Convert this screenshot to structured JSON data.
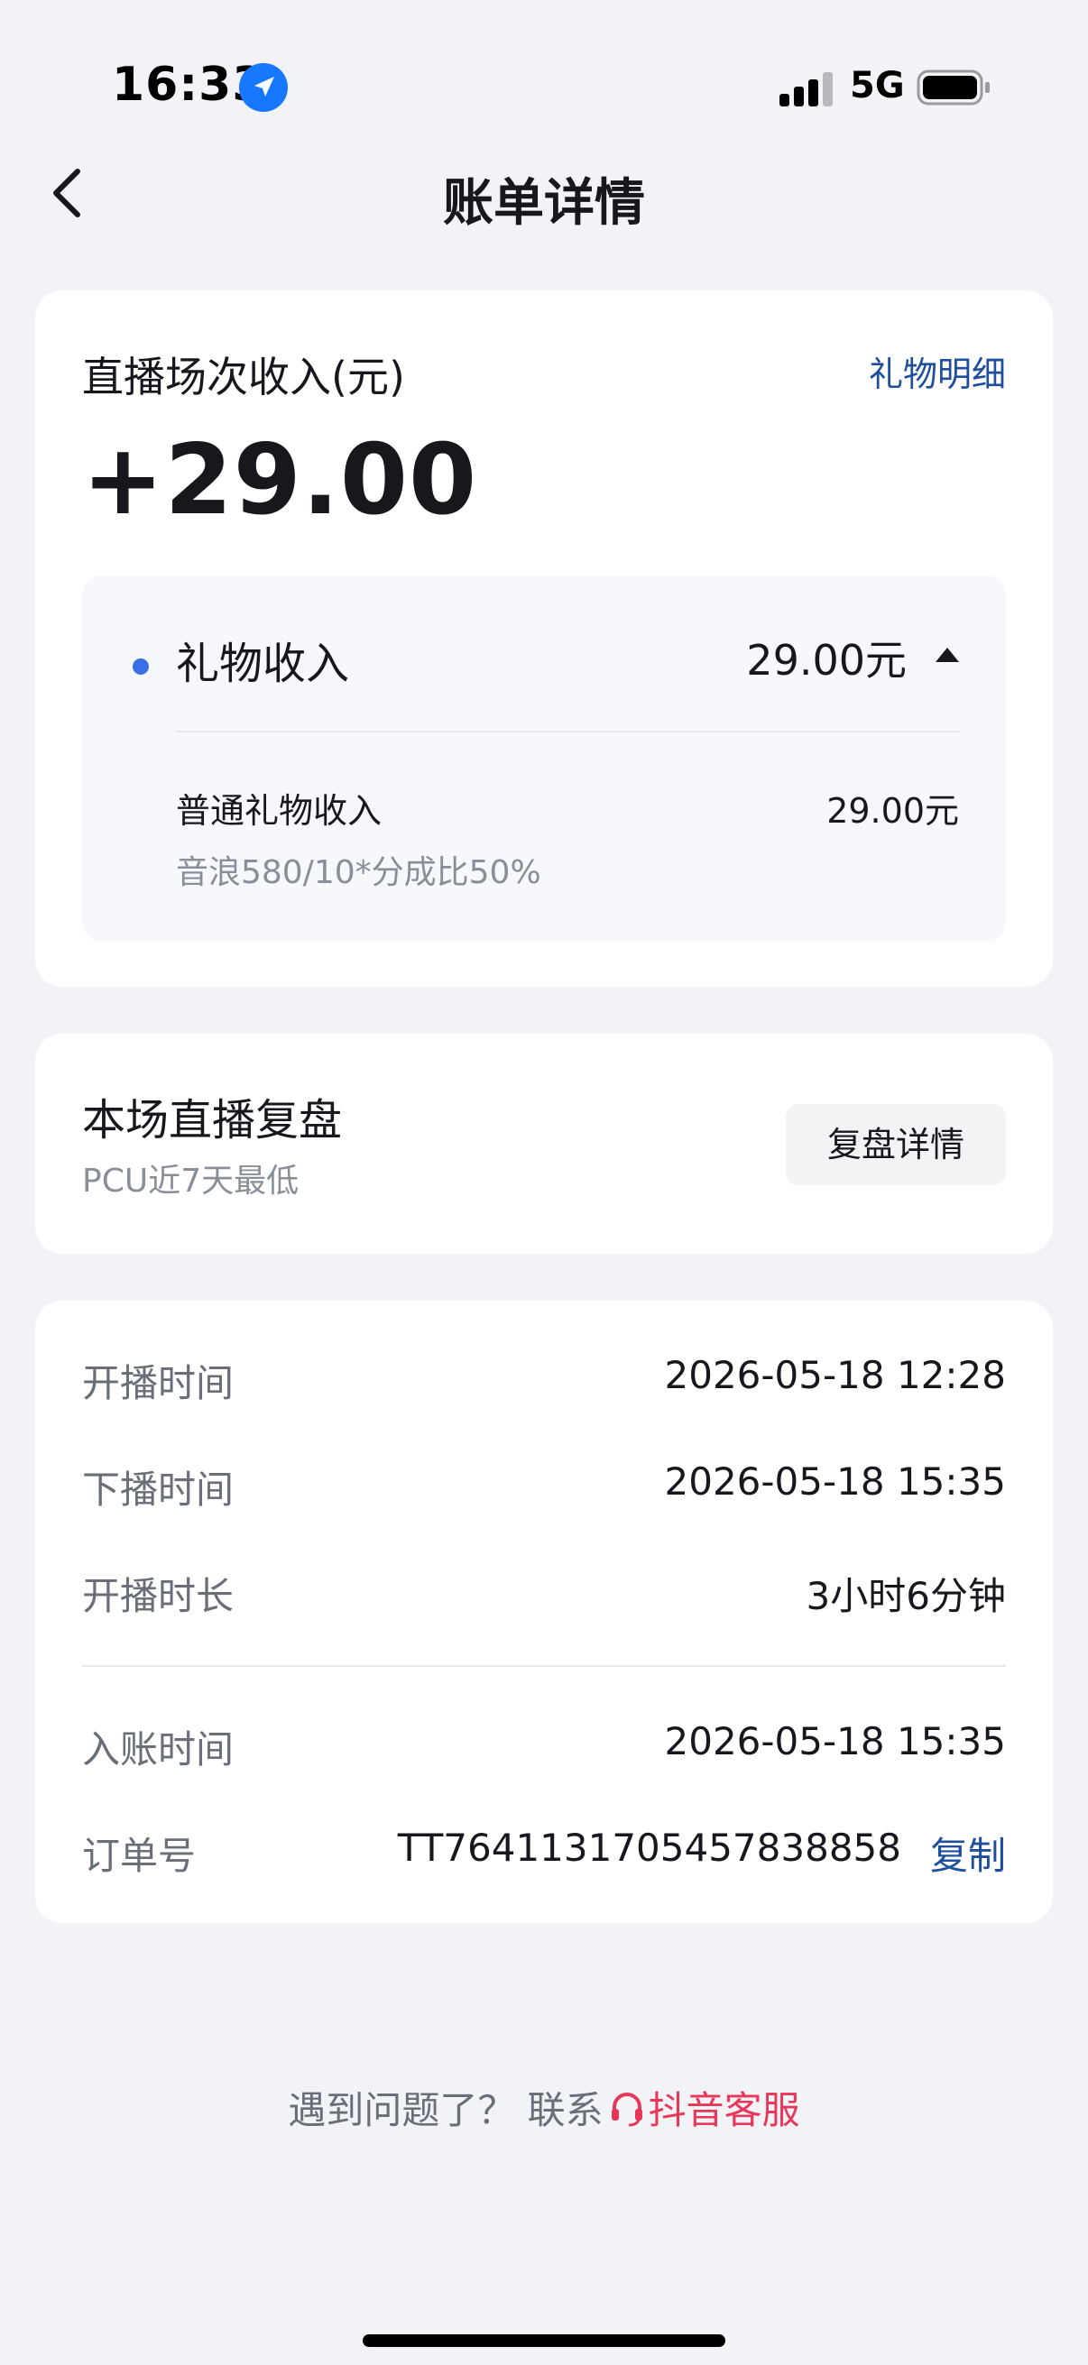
{
  "status_bar": {
    "time": "16:33",
    "network": "5G"
  },
  "nav": {
    "title": "账单详情"
  },
  "income": {
    "title": "直播场次收入(元)",
    "detail_link": "礼物明细",
    "amount": "+29.00",
    "gift_income_label": "礼物收入",
    "gift_income_value": "29.00元",
    "normal_gift_label": "普通礼物收入",
    "normal_gift_value": "29.00元",
    "normal_gift_formula": "音浪580/10*分成比50%"
  },
  "review": {
    "title": "本场直播复盘",
    "subtitle": "PCU近7天最低",
    "button": "复盘详情"
  },
  "info": {
    "rows": [
      {
        "label": "开播时间",
        "value": "2026-05-18 12:28"
      },
      {
        "label": "下播时间",
        "value": "2026-05-18 15:35"
      },
      {
        "label": "开播时长",
        "value": "3小时6分钟"
      },
      {
        "label": "入账时间",
        "value": "2026-05-18 15:35"
      }
    ],
    "order_label": "订单号",
    "order_value": "TT7641131705457838858",
    "copy_label": "复制"
  },
  "footer": {
    "prefix": "遇到问题了？ 联系",
    "service_link": "抖音客服"
  },
  "colors": {
    "accent_link": "#1f4f9c",
    "service_red": "#e8385a",
    "dot_blue": "#3b6fe6",
    "background": "#f2f3f7"
  }
}
